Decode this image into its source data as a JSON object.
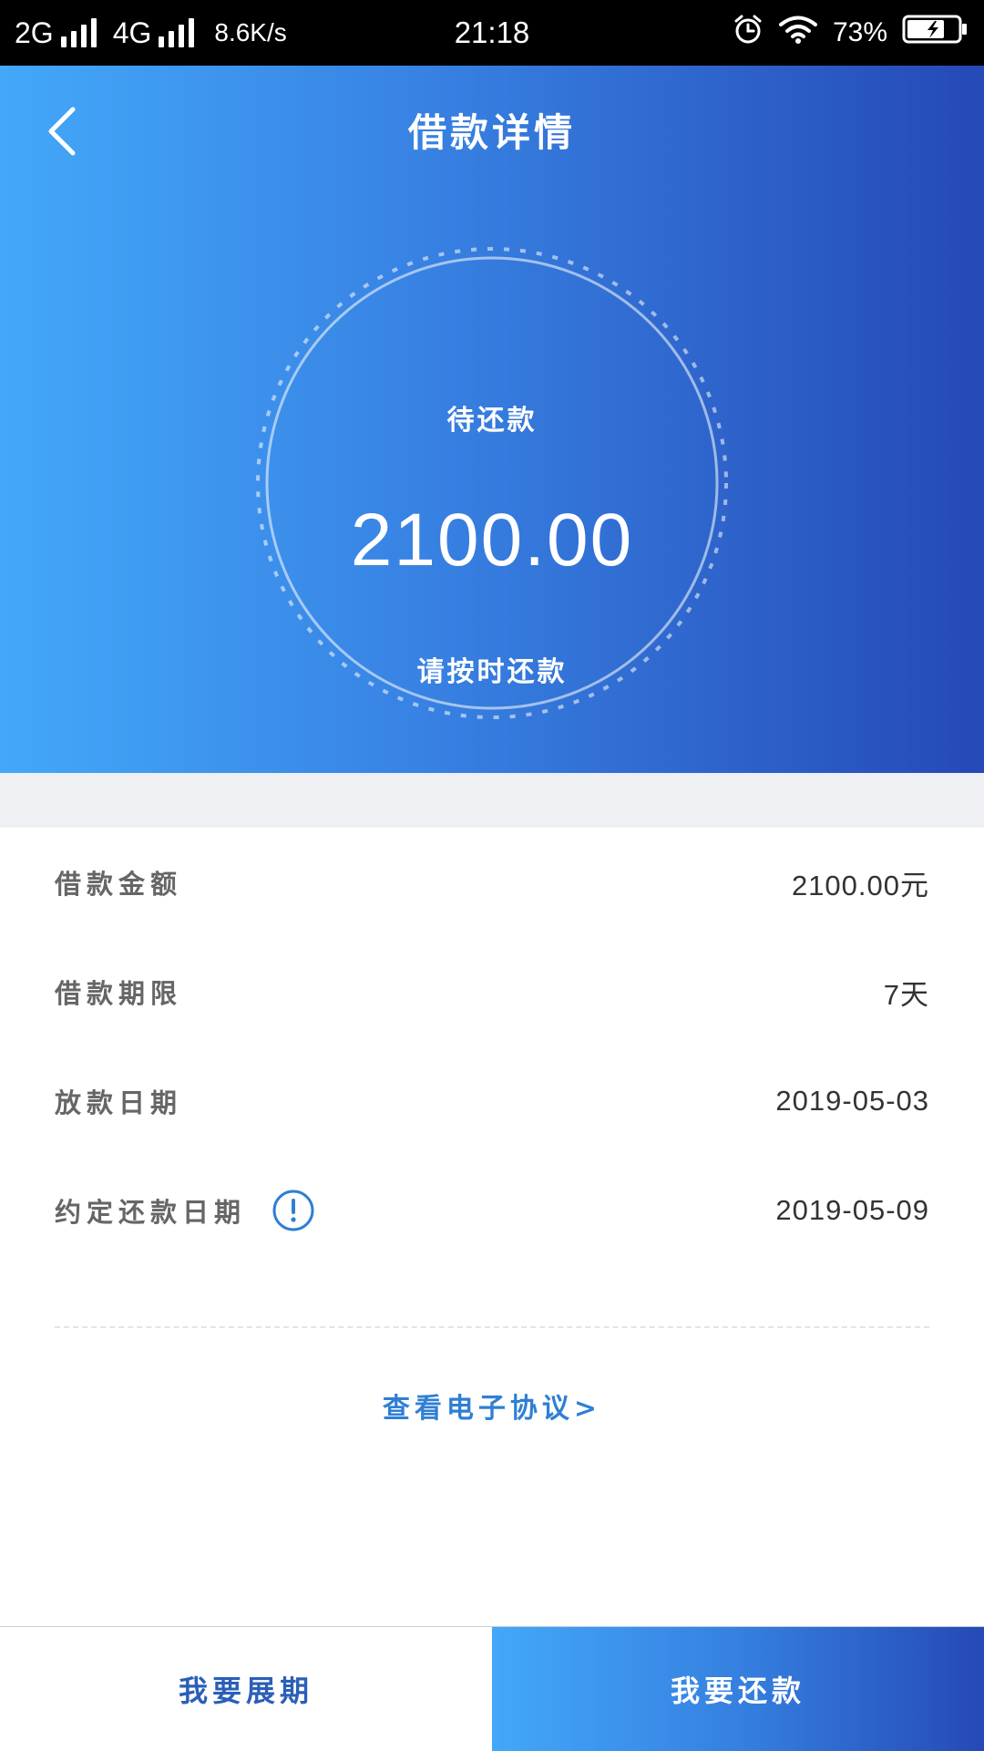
{
  "status_bar": {
    "network_1": "2G",
    "network_2": "4G",
    "speed": "8.6K/s",
    "time": "21:18",
    "battery": "73%",
    "icons": [
      "signal-icon",
      "alarm-icon",
      "wifi-icon",
      "battery-charging-icon"
    ]
  },
  "header": {
    "title": "借款详情",
    "back_icon": "chevron-left-icon"
  },
  "summary": {
    "label": "待还款",
    "amount": "2100.00",
    "reminder": "请按时还款"
  },
  "details": [
    {
      "label": "借款金额",
      "value": "2100.00元"
    },
    {
      "label": "借款期限",
      "value": "7天"
    },
    {
      "label": "放款日期",
      "value": "2019-05-03"
    },
    {
      "label": "约定还款日期",
      "value": "2019-05-09",
      "icon": "info-icon"
    }
  ],
  "agreement_link": "查看电子协议>",
  "actions": {
    "extend": "我要展期",
    "repay": "我要还款"
  },
  "colors": {
    "gradient_start": "#43a8f9",
    "gradient_end": "#2549b6",
    "link": "#2f7fd4",
    "secondary_button_text": "#2a5fb8",
    "band": "#eef0f3"
  }
}
